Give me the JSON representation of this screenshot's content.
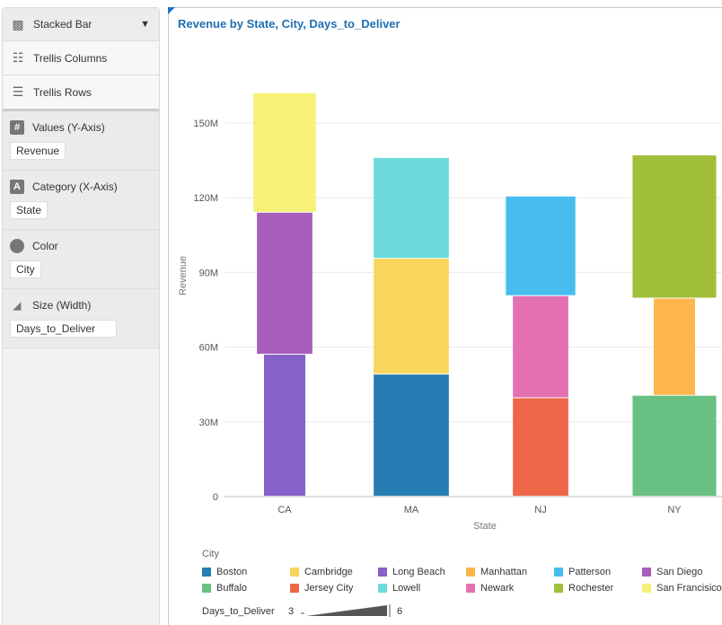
{
  "sidebar": {
    "chart_type": "Stacked Bar",
    "trellis_columns": "Trellis Columns",
    "trellis_rows": "Trellis Rows",
    "sections": [
      {
        "label": "Values (Y-Axis)",
        "value": "Revenue",
        "icon": "hash-icon"
      },
      {
        "label": "Category (X-Axis)",
        "value": "State",
        "icon": "letter-a-icon"
      },
      {
        "label": "Color",
        "value": "City",
        "icon": "palette-icon"
      },
      {
        "label": "Size (Width)",
        "value": "Days_to_Deliver",
        "icon": "size-icon"
      }
    ]
  },
  "chart_data": {
    "type": "bar",
    "stacked": true,
    "title": "Revenue by State, City, Days_to_Deliver",
    "xlabel": "State",
    "ylabel": "Revenue",
    "ylim": [
      0,
      165
    ],
    "yticks": [
      "0",
      "30M",
      "60M",
      "90M",
      "120M",
      "150M"
    ],
    "ytick_values": [
      0,
      30,
      60,
      90,
      120,
      150
    ],
    "categories": [
      "CA",
      "MA",
      "NJ",
      "NY"
    ],
    "grid": true,
    "stacks": {
      "CA": [
        {
          "city": "Long Beach",
          "value": 57,
          "days": 3
        },
        {
          "city": "San Diego",
          "value": 57,
          "days": 4
        },
        {
          "city": "San Francisico",
          "value": 48,
          "days": 4.5
        }
      ],
      "MA": [
        {
          "city": "Boston",
          "value": 49,
          "days": 5.4
        },
        {
          "city": "Cambridge",
          "value": 46.5,
          "days": 5.4
        },
        {
          "city": "Lowell",
          "value": 40.5,
          "days": 5.4
        }
      ],
      "NJ": [
        {
          "city": "Jersey City",
          "value": 39.5,
          "days": 4
        },
        {
          "city": "Newark",
          "value": 41,
          "days": 4
        },
        {
          "city": "Patterson",
          "value": 40,
          "days": 5
        }
      ],
      "NY": [
        {
          "city": "Buffalo",
          "value": 40.5,
          "days": 6
        },
        {
          "city": "Manhattan",
          "value": 39,
          "days": 3
        },
        {
          "city": "Rochester",
          "value": 57.5,
          "days": 6
        }
      ]
    },
    "legend": {
      "title": "City",
      "entries": [
        {
          "name": "Boston",
          "color": "#267db3"
        },
        {
          "name": "Cambridge",
          "color": "#fad55c"
        },
        {
          "name": "Long Beach",
          "color": "#8561c8"
        },
        {
          "name": "Manhattan",
          "color": "#ffb54d"
        },
        {
          "name": "Patterson",
          "color": "#47bdef"
        },
        {
          "name": "San Diego",
          "color": "#a75dba"
        },
        {
          "name": "Buffalo",
          "color": "#68c182"
        },
        {
          "name": "Jersey City",
          "color": "#ed6647"
        },
        {
          "name": "Lowell",
          "color": "#6ddbdb"
        },
        {
          "name": "Newark",
          "color": "#e371b2"
        },
        {
          "name": "Rochester",
          "color": "#a2bf39"
        },
        {
          "name": "San Francisico",
          "color": "#f6f277"
        }
      ],
      "placement": "bottom"
    },
    "size_legend": {
      "title": "Days_to_Deliver",
      "min": "3",
      "max": "6"
    }
  }
}
